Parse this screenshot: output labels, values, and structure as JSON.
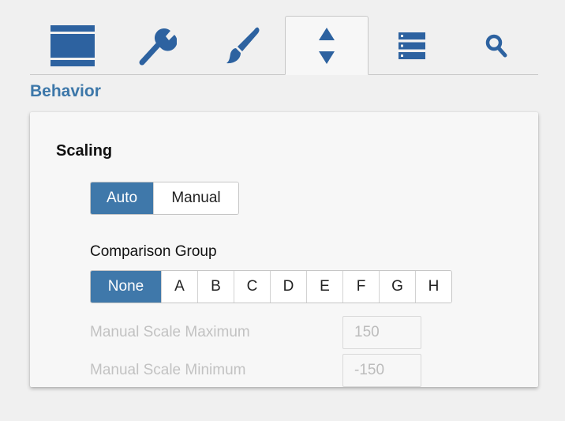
{
  "tabs": [
    {
      "icon": "layout-icon",
      "active": false
    },
    {
      "icon": "wrench-icon",
      "active": false
    },
    {
      "icon": "paintbrush-icon",
      "active": false
    },
    {
      "icon": "sort-arrows-icon",
      "active": true
    },
    {
      "icon": "list-icon",
      "active": false
    },
    {
      "icon": "search-icon",
      "active": false
    }
  ],
  "colors": {
    "accent": "#3f78aa",
    "section_title": "#3c77a9",
    "icon": "#2d62a0",
    "background": "#f0f0f0",
    "panel": "#f7f7f7",
    "disabled_text": "#c2c2c2"
  },
  "section_title": "Behavior",
  "panel": {
    "title": "Scaling",
    "scaling_options": [
      "Auto",
      "Manual"
    ],
    "scaling_selected": "Auto",
    "comparison_group_label": "Comparison Group",
    "comparison_group_options": [
      "None",
      "A",
      "B",
      "C",
      "D",
      "E",
      "F",
      "G",
      "H"
    ],
    "comparison_group_selected": "None",
    "manual_max": {
      "label": "Manual Scale Maximum",
      "placeholder": "150"
    },
    "manual_min": {
      "label": "Manual Scale Minimum",
      "placeholder": "-150"
    }
  }
}
